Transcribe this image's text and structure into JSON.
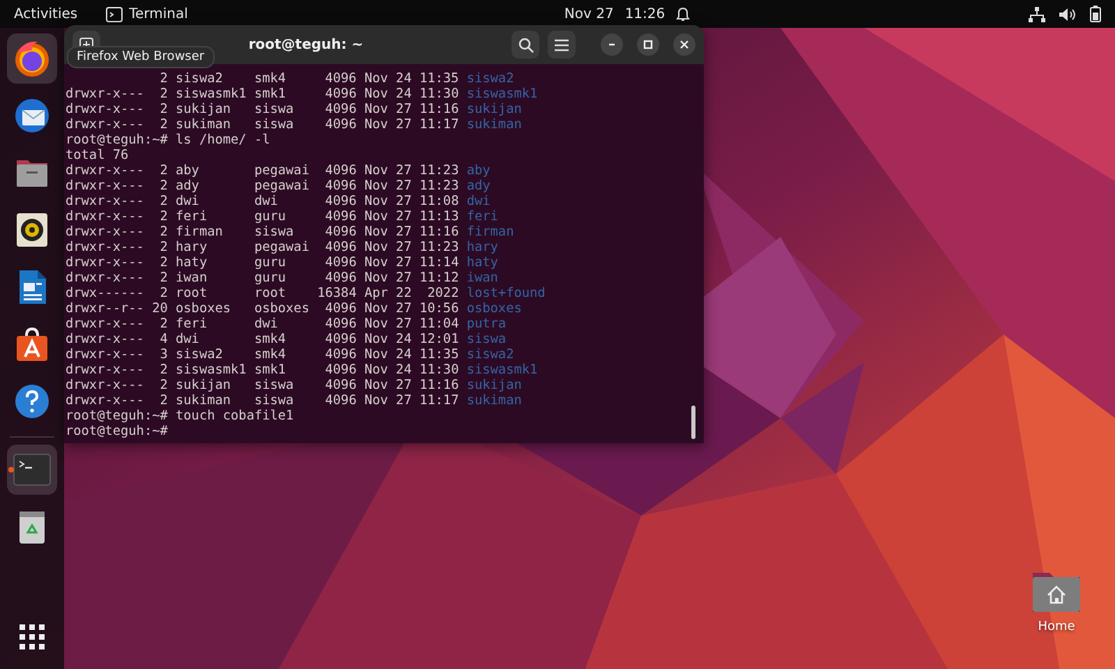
{
  "top_bar": {
    "activities": "Activities",
    "app": "Terminal",
    "date": "Nov 27",
    "time": "11:26"
  },
  "dock": {
    "items": [
      {
        "kind": "browser",
        "highlighted": true,
        "running": false
      },
      {
        "kind": "mail",
        "highlighted": false,
        "running": false
      },
      {
        "kind": "files",
        "highlighted": false,
        "running": false
      },
      {
        "kind": "music",
        "highlighted": false,
        "running": false
      },
      {
        "kind": "writer",
        "highlighted": false,
        "running": false
      },
      {
        "kind": "store",
        "highlighted": false,
        "running": false
      },
      {
        "kind": "help",
        "highlighted": false,
        "running": false
      },
      {
        "kind": "terminal",
        "highlighted": true,
        "running": true
      },
      {
        "kind": "trash",
        "highlighted": false,
        "running": false
      }
    ]
  },
  "tooltip": "Firefox Web Browser",
  "terminal": {
    "title": "root@teguh: ~",
    "lines": [
      {
        "kind": "partial",
        "text": "2 siswa2    smk4     4096 Nov 24 11:35",
        "dir": "siswa2"
      },
      {
        "kind": "listing",
        "text": "drwxr-x---  2 siswasmk1 smk1     4096 Nov 24 11:30",
        "dir": "siswasmk1"
      },
      {
        "kind": "listing",
        "text": "drwxr-x---  2 sukijan   siswa    4096 Nov 27 11:16",
        "dir": "sukijan"
      },
      {
        "kind": "listing",
        "text": "drwxr-x---  2 sukiman   siswa    4096 Nov 27 11:17",
        "dir": "sukiman"
      },
      {
        "kind": "plain",
        "text": "root@teguh:~# ls /home/ -l"
      },
      {
        "kind": "plain",
        "text": "total 76"
      },
      {
        "kind": "listing",
        "text": "drwxr-x---  2 aby       pegawai  4096 Nov 27 11:23",
        "dir": "aby"
      },
      {
        "kind": "listing",
        "text": "drwxr-x---  2 ady       pegawai  4096 Nov 27 11:23",
        "dir": "ady"
      },
      {
        "kind": "listing",
        "text": "drwxr-x---  2 dwi       dwi      4096 Nov 27 11:08",
        "dir": "dwi"
      },
      {
        "kind": "listing",
        "text": "drwxr-x---  2 feri      guru     4096 Nov 27 11:13",
        "dir": "feri"
      },
      {
        "kind": "listing",
        "text": "drwxr-x---  2 firman    siswa    4096 Nov 27 11:16",
        "dir": "firman"
      },
      {
        "kind": "listing",
        "text": "drwxr-x---  2 hary      pegawai  4096 Nov 27 11:23",
        "dir": "hary"
      },
      {
        "kind": "listing",
        "text": "drwxr-x---  2 haty      guru     4096 Nov 27 11:14",
        "dir": "haty"
      },
      {
        "kind": "listing",
        "text": "drwxr-x---  2 iwan      guru     4096 Nov 27 11:12",
        "dir": "iwan"
      },
      {
        "kind": "listing",
        "text": "drwx------  2 root      root    16384 Apr 22  2022",
        "dir": "lost+found"
      },
      {
        "kind": "listing",
        "text": "drwxr--r-- 20 osboxes   osboxes  4096 Nov 27 10:56",
        "dir": "osboxes"
      },
      {
        "kind": "listing",
        "text": "drwxr-x---  2 feri      dwi      4096 Nov 27 11:04",
        "dir": "putra"
      },
      {
        "kind": "listing",
        "text": "drwxr-x---  4 dwi       smk4     4096 Nov 24 12:01",
        "dir": "siswa"
      },
      {
        "kind": "listing",
        "text": "drwxr-x---  3 siswa2    smk4     4096 Nov 24 11:35",
        "dir": "siswa2"
      },
      {
        "kind": "listing",
        "text": "drwxr-x---  2 siswasmk1 smk1     4096 Nov 24 11:30",
        "dir": "siswasmk1"
      },
      {
        "kind": "listing",
        "text": "drwxr-x---  2 sukijan   siswa    4096 Nov 27 11:16",
        "dir": "sukijan"
      },
      {
        "kind": "listing",
        "text": "drwxr-x---  2 sukiman   siswa    4096 Nov 27 11:17",
        "dir": "sukiman"
      },
      {
        "kind": "plain",
        "text": "root@teguh:~# touch cobafile1"
      },
      {
        "kind": "plain",
        "text": "root@teguh:~#"
      }
    ]
  },
  "desktop_icons": [
    {
      "label": "Home"
    }
  ]
}
